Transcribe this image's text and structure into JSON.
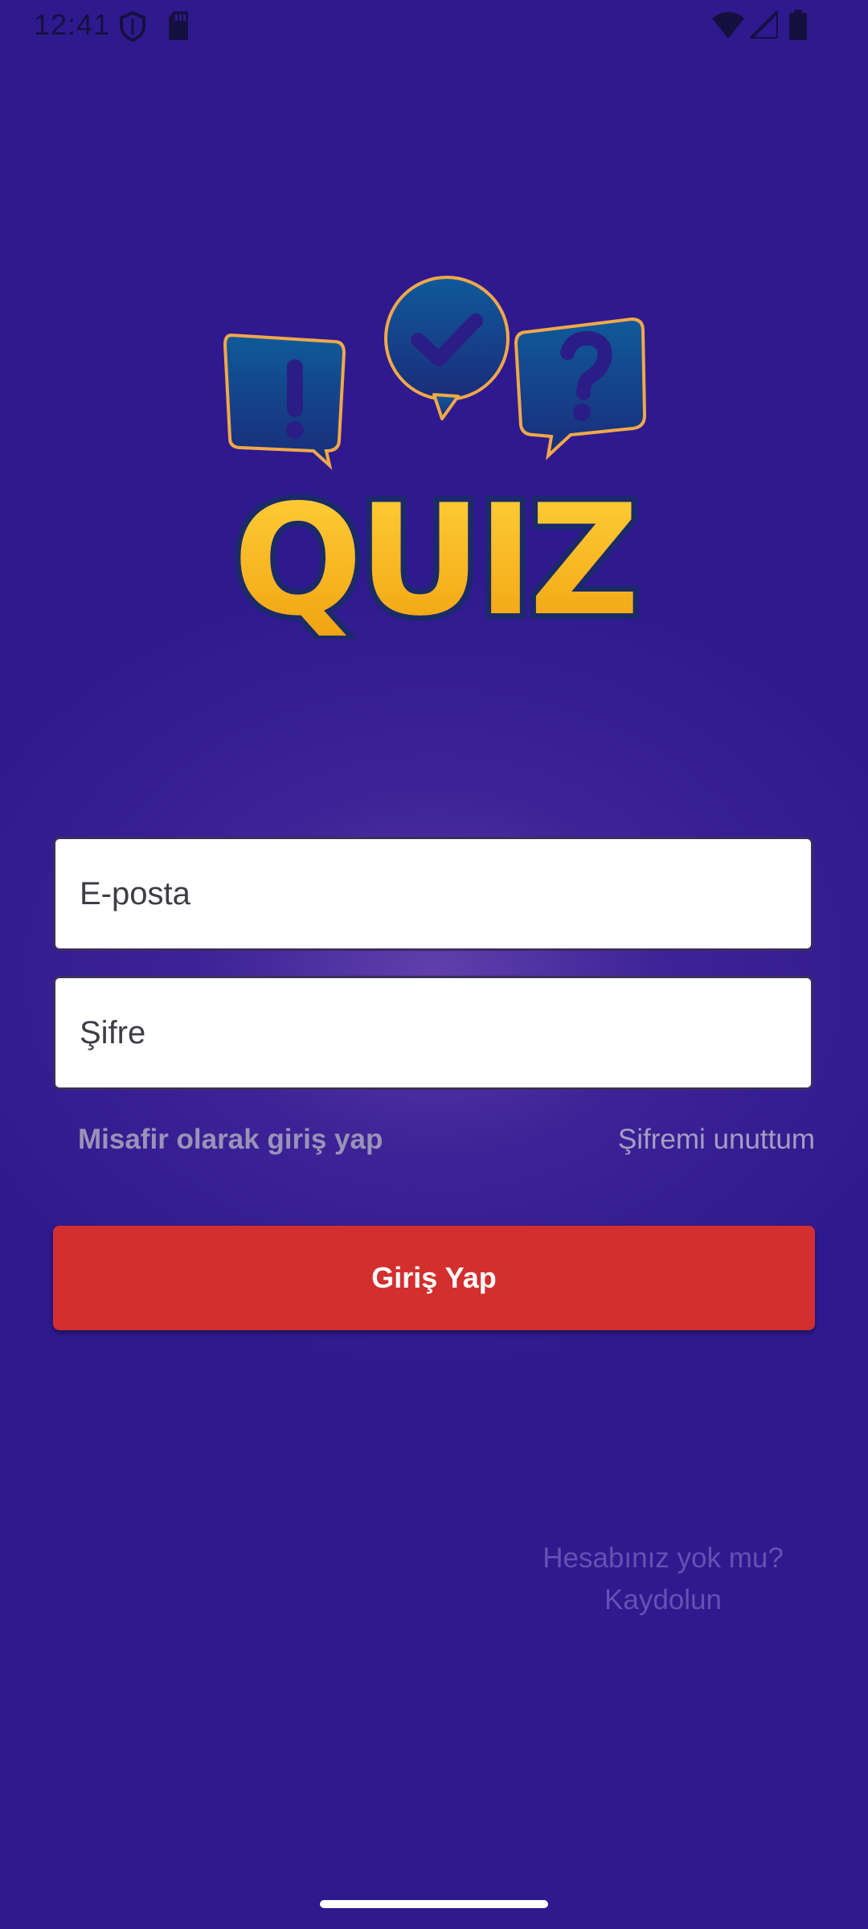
{
  "status_bar": {
    "time": "12:41",
    "left_icons": [
      "shield-icon",
      "sd-card-icon"
    ],
    "right_icons": [
      "wifi-icon",
      "cell-signal-icon",
      "battery-icon"
    ]
  },
  "logo": {
    "text": "QUIZ",
    "bubbles": [
      "!",
      "check",
      "?"
    ]
  },
  "form": {
    "email_placeholder": "E-posta",
    "password_placeholder": "Şifre",
    "guest_login": "Misafir olarak giriş yap",
    "forgot_password": "Şifremi unuttum",
    "login_button": "Giriş Yap"
  },
  "signup": {
    "question": "Hesabınız yok mu?",
    "action": "Kaydolun"
  },
  "colors": {
    "background": "#2e1a8e",
    "primary_button": "#d32f2f",
    "logo_yellow": "#f5b825",
    "bubble_blue": "#0f4f8f"
  }
}
